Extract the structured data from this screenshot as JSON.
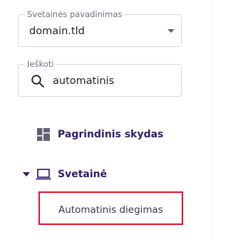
{
  "website_select": {
    "label": "Svetainės pavadinimas",
    "value": "domain.tld",
    "icon": "chevron-down-icon"
  },
  "search": {
    "label": "Ieškoti",
    "value": "automatinis",
    "icon": "search-icon"
  },
  "nav": {
    "dashboard": {
      "label": "Pagrindinis skydas",
      "icon": "dashboard-icon"
    },
    "website": {
      "label": "Svetainė",
      "icon": "laptop-icon",
      "expanded": true,
      "children": [
        {
          "label": "Automatinis diegimas",
          "highlighted": true
        }
      ]
    }
  },
  "colors": {
    "text_primary": "#2f1c6a",
    "border": "#d9d9e3",
    "highlight": "#e0102a",
    "icon_gray": "#5f6170"
  }
}
